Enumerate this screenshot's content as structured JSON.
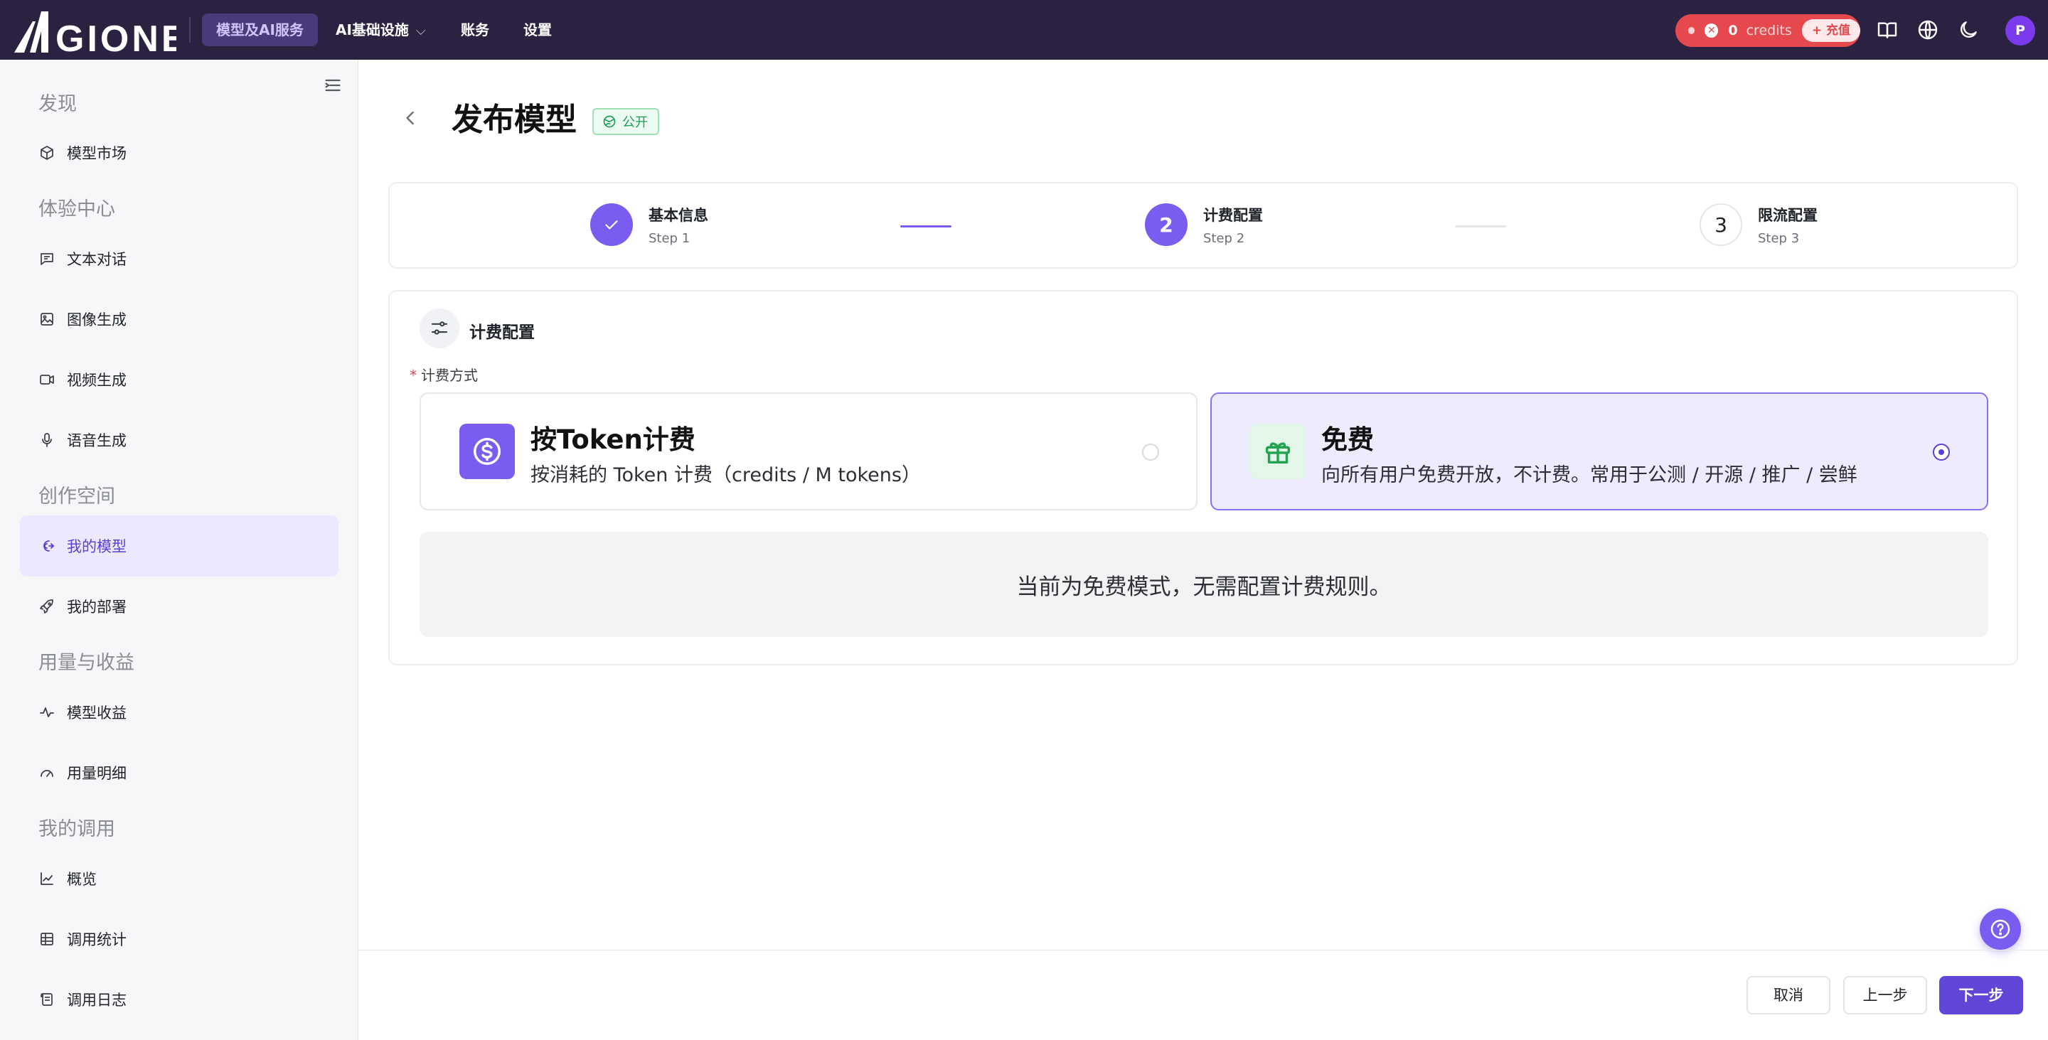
{
  "brand": {
    "name": "AIGIONE",
    "accent": "#6246d8",
    "topbar_bg": "#2b2140"
  },
  "nav": {
    "items": [
      {
        "label": "模型及AI服务",
        "active": true
      },
      {
        "label": "AI基础设施",
        "has_dropdown": true
      },
      {
        "label": "账务"
      },
      {
        "label": "设置"
      }
    ]
  },
  "credits": {
    "value": "0",
    "unit": "credits",
    "recharge": "+ 充值",
    "status_icon": "x-circle-icon"
  },
  "top_icons": [
    "book-icon",
    "globe-icon",
    "moon-icon"
  ],
  "user": {
    "avatar_letter": "P"
  },
  "sidebar": {
    "groups": [
      {
        "label": "发现",
        "items": [
          {
            "label": "模型市场",
            "icon": "box-icon"
          }
        ]
      },
      {
        "label": "体验中心",
        "items": [
          {
            "label": "文本对话",
            "icon": "chat-icon"
          },
          {
            "label": "图像生成",
            "icon": "image-icon"
          },
          {
            "label": "视频生成",
            "icon": "video-icon"
          },
          {
            "label": "语音生成",
            "icon": "mic-icon"
          }
        ]
      },
      {
        "label": "创作空间",
        "items": [
          {
            "label": "我的模型",
            "icon": "brain-icon",
            "active": true
          },
          {
            "label": "我的部署",
            "icon": "rocket-icon"
          }
        ]
      },
      {
        "label": "用量与收益",
        "items": [
          {
            "label": "模型收益",
            "icon": "pulse-icon"
          },
          {
            "label": "用量明细",
            "icon": "gauge-icon"
          }
        ]
      },
      {
        "label": "我的调用",
        "items": [
          {
            "label": "概览",
            "icon": "line-chart-icon"
          },
          {
            "label": "调用统计",
            "icon": "table-icon"
          },
          {
            "label": "调用日志",
            "icon": "scroll-icon"
          }
        ]
      }
    ]
  },
  "page": {
    "title": "发布模型",
    "badge": "公开"
  },
  "steps": [
    {
      "title": "基本信息",
      "sub": "Step 1",
      "state": "done"
    },
    {
      "title": "计费配置",
      "sub": "Step 2",
      "state": "current",
      "number": "2"
    },
    {
      "title": "限流配置",
      "sub": "Step 3",
      "state": "todo",
      "number": "3"
    }
  ],
  "billing": {
    "section_title": "计费配置",
    "field_label": "计费方式",
    "options": [
      {
        "title": "按Token计费",
        "desc": "按消耗的 Token 计费（credits / M tokens）",
        "selected": false
      },
      {
        "title": "免费",
        "desc": "向所有用户免费开放，不计费。常用于公测 / 开源 / 推广 / 尝鲜",
        "selected": true
      }
    ],
    "free_note": "当前为免费模式，无需配置计费规则。"
  },
  "footer": {
    "cancel": "取消",
    "prev": "上一步",
    "next": "下一步"
  }
}
